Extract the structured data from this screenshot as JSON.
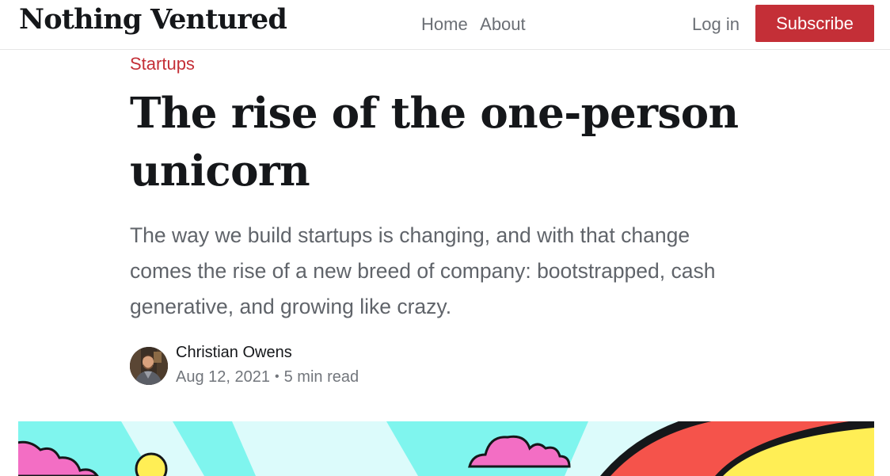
{
  "site": {
    "title": "Nothing Ventured"
  },
  "nav": {
    "items": [
      {
        "label": "Home"
      },
      {
        "label": "About"
      }
    ],
    "login_label": "Log in",
    "subscribe_label": "Subscribe"
  },
  "article": {
    "category": "Startups",
    "title": "The rise of the one-person unicorn",
    "excerpt": "The way we build startups is changing, and with that change comes the rise of a new breed of company: bootstrapped, cash generative, and growing like crazy.",
    "author": "Christian Owens",
    "date": "Aug 12, 2021",
    "reading_time": "5 min read"
  },
  "icons": {
    "meta_separator": "•"
  },
  "colors": {
    "accent": "#c42f37",
    "title_text": "#15171a",
    "muted_text": "#6b6f75",
    "header_border": "#e6e6e6",
    "illustration_cyan": "#7ff5ee",
    "illustration_light": "#dcfbfb",
    "illustration_pink": "#f36ec4",
    "illustration_yellow": "#ffee55",
    "illustration_red": "#f5534b"
  }
}
